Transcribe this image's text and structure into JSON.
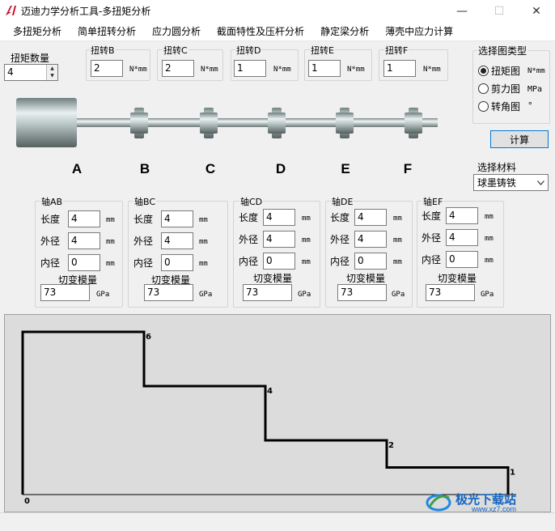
{
  "window": {
    "title": "迈迪力学分析工具-多扭矩分析",
    "minimize_glyph": "—",
    "maximize_glyph": "☐",
    "close_glyph": "✕"
  },
  "menu": [
    "多扭矩分析",
    "简单扭转分析",
    "应力圆分析",
    "截面特性及压杆分析",
    "静定梁分析",
    "薄壳中应力计算"
  ],
  "torque_count": {
    "label": "扭矩数量",
    "value": "4"
  },
  "torques": [
    {
      "label": "扭转B",
      "value": "2",
      "unit": "N*mm"
    },
    {
      "label": "扭转C",
      "value": "2",
      "unit": "N*mm"
    },
    {
      "label": "扭转D",
      "value": "1",
      "unit": "N*mm"
    },
    {
      "label": "扭转E",
      "value": "1",
      "unit": "N*mm"
    },
    {
      "label": "扭转F",
      "value": "1",
      "unit": "N*mm"
    }
  ],
  "chart_type": {
    "label": "选择图类型",
    "options": [
      {
        "label": "扭矩图",
        "unit": "N*mm",
        "selected": true
      },
      {
        "label": "剪力图",
        "unit": "MPa",
        "selected": false
      },
      {
        "label": "转角图",
        "unit": "°",
        "selected": false
      }
    ]
  },
  "calc_button": "计算",
  "material": {
    "label": "选择材料",
    "value": "球墨铸铁"
  },
  "section_letters": [
    "A",
    "B",
    "C",
    "D",
    "E",
    "F"
  ],
  "shafts": [
    {
      "label": "轴AB",
      "length": "4",
      "outer": "4",
      "inner": "0",
      "modulus": "73"
    },
    {
      "label": "轴BC",
      "length": "4",
      "outer": "4",
      "inner": "0",
      "modulus": "73"
    },
    {
      "label": "轴CD",
      "length": "4",
      "outer": "4",
      "inner": "0",
      "modulus": "73"
    },
    {
      "label": "轴DE",
      "length": "4",
      "outer": "4",
      "inner": "0",
      "modulus": "73"
    },
    {
      "label": "轴EF",
      "length": "4",
      "outer": "4",
      "inner": "0",
      "modulus": "73"
    }
  ],
  "shaft_labels": {
    "length": "长度",
    "outer": "外径",
    "inner": "内径",
    "modulus": "切变模量",
    "mm": "mm",
    "gpa": "GPa"
  },
  "colors": {
    "accent": "#0078d7",
    "chart_bg": "#dcdcdc",
    "line": "#000000"
  },
  "chart_data": {
    "type": "line",
    "step": true,
    "title": "",
    "xlabel": "",
    "ylabel": "",
    "x": [
      0,
      1,
      2,
      3,
      4
    ],
    "values": [
      6,
      4,
      2,
      1,
      0
    ],
    "point_labels": [
      "6",
      "4",
      "2",
      "1",
      "0"
    ],
    "ylim": [
      0,
      6
    ]
  },
  "watermark": {
    "brand": "极光下载站",
    "url": "www.xz7.com"
  }
}
